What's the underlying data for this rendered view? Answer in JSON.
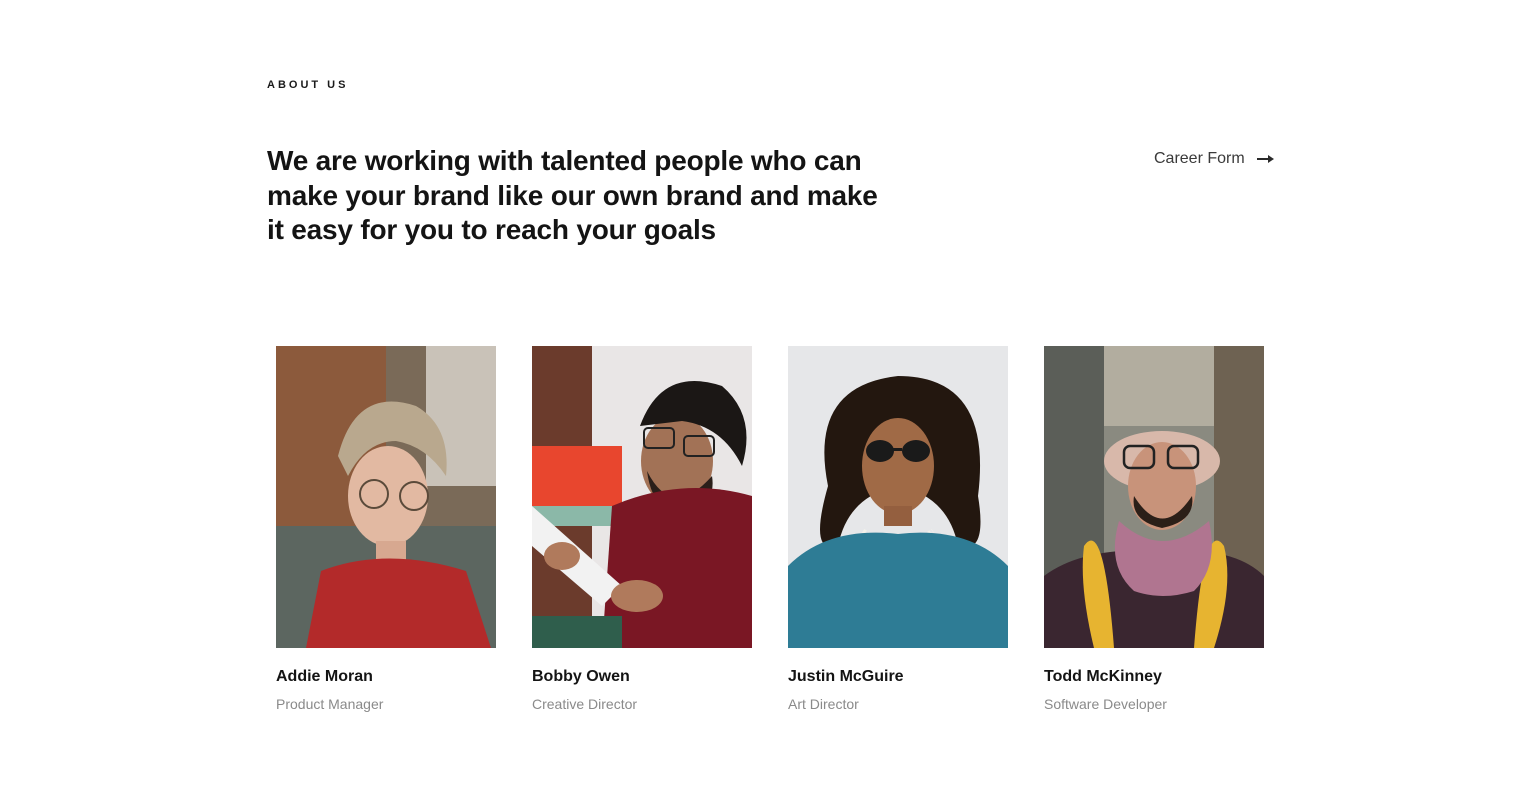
{
  "section": {
    "eyebrow": "ABOUT US",
    "headline": "We are working with talented people who can make your brand like our own brand and make it easy for you to reach your goals",
    "career_link": {
      "label": "Career Form",
      "icon": "arrow-right-icon"
    }
  },
  "team": [
    {
      "name": "Addie Moran",
      "role": "Product Manager"
    },
    {
      "name": "Bobby Owen",
      "role": "Creative Director"
    },
    {
      "name": "Justin McGuire",
      "role": "Art Director"
    },
    {
      "name": "Todd McKinney",
      "role": "Software Developer"
    }
  ]
}
